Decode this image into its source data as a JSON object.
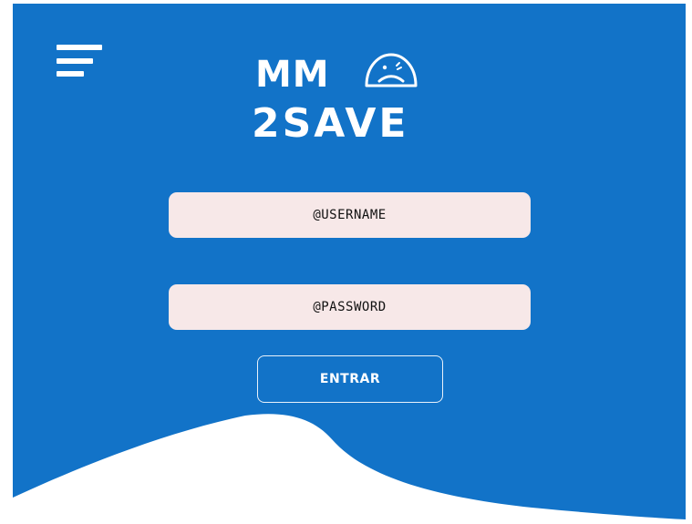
{
  "logo": {
    "line1": "MM",
    "line2": "2SAVE",
    "icon": "sad-face-icon"
  },
  "menu": {
    "icon": "hamburger-menu-icon"
  },
  "form": {
    "username_label": "@USERNAME",
    "password_label": "@PASSWORD",
    "submit_label": "ENTRAR"
  },
  "colors": {
    "background": "#1273c8",
    "field_background": "#f7e8e8",
    "wave": "#ffffff",
    "text_on_blue": "#ffffff"
  }
}
